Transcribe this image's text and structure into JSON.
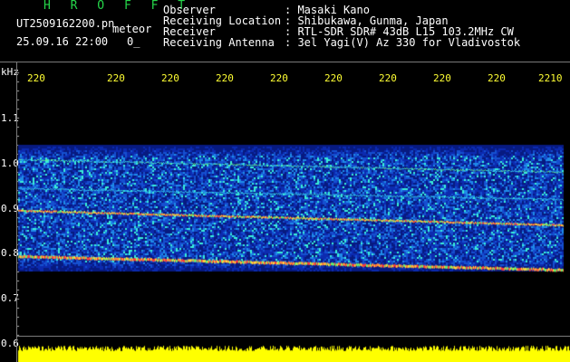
{
  "app_title": "H R O F F T",
  "file_name": "UT2509162200.pn",
  "event_type": "meteor",
  "date_time": "25.09.16 22:00",
  "counter": "0_",
  "info_labels": [
    "Observer",
    "Receiving Location",
    "Receiver",
    "Receiving Antenna"
  ],
  "info_values": [
    ": Masaki Kano",
    ": Shibukawa, Gunma, Japan",
    ": RTL-SDR SDR# 43dB L15 103.2MHz CW",
    ": 3el Yagi(V) Az 330 for Vladivostok"
  ],
  "time_labels": [
    "220",
    "220",
    "220",
    "220",
    "220",
    "220",
    "220",
    "220",
    "220",
    "2210"
  ],
  "freq_unit": "kHz",
  "freq_labels": [
    "1.1",
    "1.0",
    "0.9",
    "0.8",
    "0.7",
    "0.6"
  ],
  "colors": {
    "background": "#000000",
    "title_green": "#25d64a",
    "label_yellow": "#ffff33",
    "spectrum_base": "#0a1a9a",
    "level_bar": "#ffff00"
  }
}
